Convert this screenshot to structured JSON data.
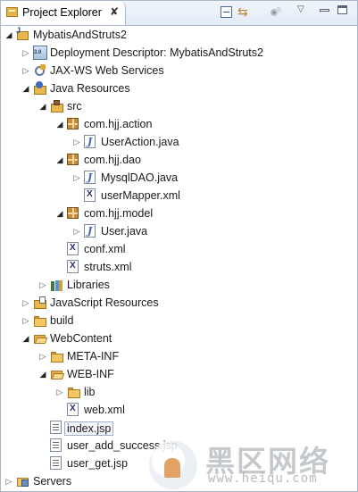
{
  "view": {
    "title": "Project Explorer",
    "close_glyph": "✘",
    "toolbar": {
      "icons": [
        "collapse-all-icon",
        "link-with-editor-icon",
        "focus-on-active-task-icon",
        "view-menu-icon",
        "minimize-icon",
        "maximize-icon"
      ],
      "menu_glyph": "▽",
      "link_glyph": "⇆"
    }
  },
  "tree": [
    {
      "label": "MybatisAndStruts2",
      "icon": "java-project-icon",
      "expanded": true
    },
    {
      "label": "Deployment Descriptor: MybatisAndStruts2",
      "icon": "deployment-descriptor-icon",
      "expanded": false
    },
    {
      "label": "JAX-WS Web Services",
      "icon": "web-services-icon",
      "expanded": false
    },
    {
      "label": "Java Resources",
      "icon": "java-resources-icon",
      "expanded": true
    },
    {
      "label": "src",
      "icon": "source-folder-icon",
      "expanded": true
    },
    {
      "label": "com.hjj.action",
      "icon": "package-icon",
      "expanded": true
    },
    {
      "label": "UserAction.java",
      "icon": "java-file-icon",
      "expanded": false
    },
    {
      "label": "com.hjj.dao",
      "icon": "package-icon",
      "expanded": true
    },
    {
      "label": "MysqlDAO.java",
      "icon": "java-file-icon",
      "expanded": false
    },
    {
      "label": "userMapper.xml",
      "icon": "xml-file-icon"
    },
    {
      "label": "com.hjj.model",
      "icon": "package-icon",
      "expanded": true
    },
    {
      "label": "User.java",
      "icon": "java-file-icon",
      "expanded": false
    },
    {
      "label": "conf.xml",
      "icon": "xml-file-icon"
    },
    {
      "label": "struts.xml",
      "icon": "xml-file-icon"
    },
    {
      "label": "Libraries",
      "icon": "libraries-icon",
      "expanded": false
    },
    {
      "label": "JavaScript Resources",
      "icon": "javascript-resources-icon",
      "expanded": false
    },
    {
      "label": "build",
      "icon": "folder-icon",
      "expanded": false
    },
    {
      "label": "WebContent",
      "icon": "folder-open-icon",
      "expanded": true
    },
    {
      "label": "META-INF",
      "icon": "folder-icon",
      "expanded": false
    },
    {
      "label": "WEB-INF",
      "icon": "folder-open-icon",
      "expanded": true
    },
    {
      "label": "lib",
      "icon": "folder-icon",
      "expanded": false
    },
    {
      "label": "web.xml",
      "icon": "xml-file-icon"
    },
    {
      "label": "index.jsp",
      "icon": "jsp-file-icon",
      "selected": true
    },
    {
      "label": "user_add_success.jsp",
      "icon": "jsp-file-icon"
    },
    {
      "label": "user_get.jsp",
      "icon": "jsp-file-icon"
    },
    {
      "label": "Servers",
      "icon": "servers-icon",
      "expanded": false
    }
  ],
  "watermark": {
    "text": "黑区网络",
    "url": "www.heiqu.com"
  },
  "glyphs": {
    "collapsed": "▷",
    "expanded": "◢"
  }
}
